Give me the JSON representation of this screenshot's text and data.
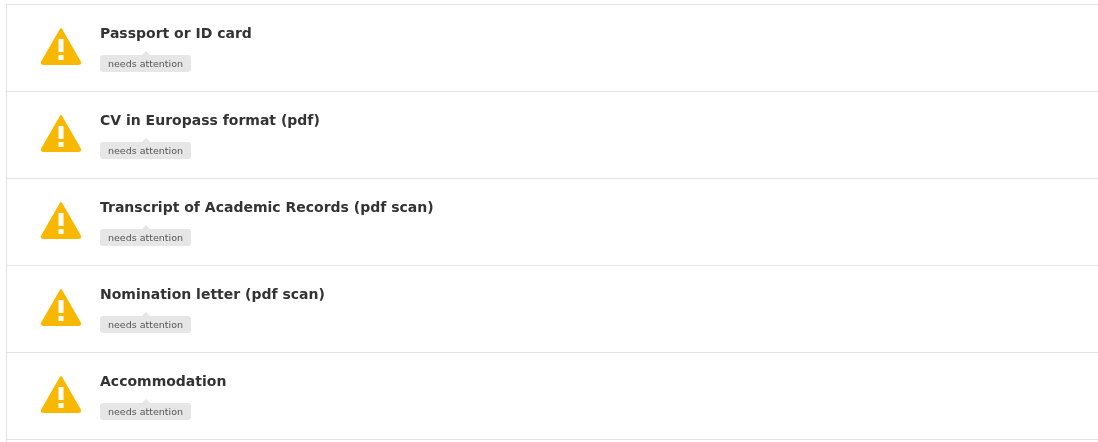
{
  "items": [
    {
      "title": "Passport or ID card",
      "kind": "warning",
      "badge": "needs attention"
    },
    {
      "title": "CV in Europass format (pdf)",
      "kind": "warning",
      "badge": "needs attention"
    },
    {
      "title": "Transcript of Academic Records (pdf scan)",
      "kind": "warning",
      "badge": "needs attention"
    },
    {
      "title": "Nomination letter (pdf scan)",
      "kind": "warning",
      "badge": "needs attention"
    },
    {
      "title": "Accommodation",
      "kind": "warning",
      "badge": "needs attention"
    }
  ]
}
